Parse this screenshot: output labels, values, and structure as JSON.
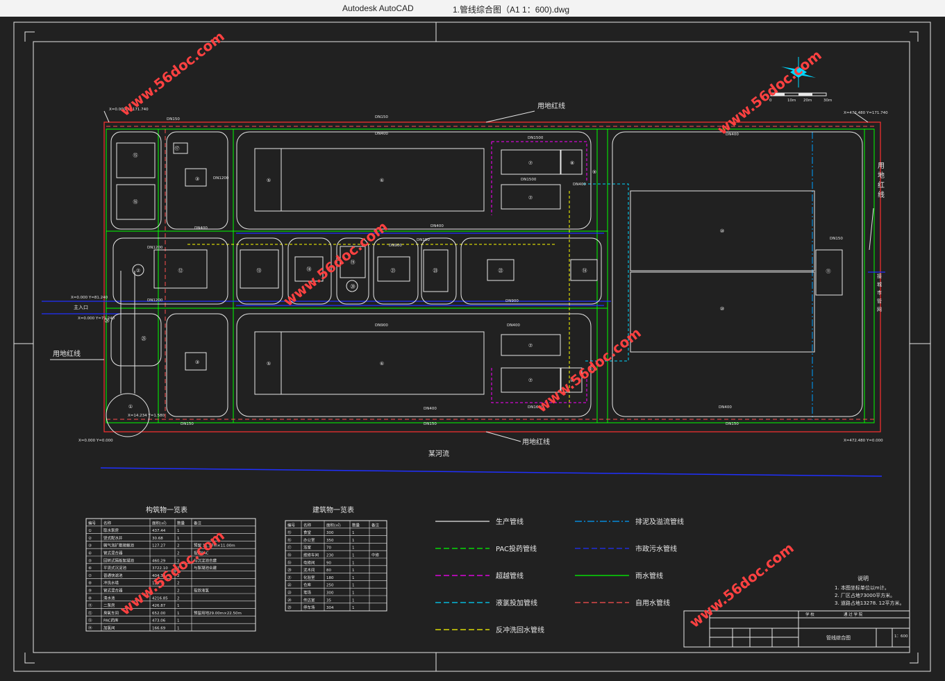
{
  "titlebar": {
    "app": "Autodesk AutoCAD",
    "file": "1.管线综合图（A1 1：600).dwg"
  },
  "labels": {
    "red_line_top": "用地红线",
    "red_line_left": "用地红线",
    "red_line_bottom": "用地红线",
    "red_line_right": [
      "用",
      "地",
      "红",
      "线"
    ],
    "river": "某河流",
    "main_entrance": "主入口",
    "sewer_right": [
      "接",
      "城",
      "市",
      "管",
      "网"
    ]
  },
  "pipe_labels": [
    "DN150",
    "DN400",
    "DN1500",
    "DN1500",
    "DN400",
    "DN150",
    "DN400",
    "DN1200",
    "DN1200",
    "DN400",
    "DN400",
    "DN900",
    "DN900",
    "DN400",
    "DN150",
    "DN150",
    "DN1600",
    "DN150",
    "DN400",
    "DN400",
    "DN900",
    "DN1200",
    "DN150"
  ],
  "watermark": "www.56doc.com",
  "scalebar": [
    "0",
    "10m",
    "20m",
    "30m"
  ],
  "structures_table": {
    "title": "构筑物一览表",
    "headers": [
      "编号",
      "名称",
      "面积(㎡)",
      "数量",
      "备注"
    ],
    "rows": [
      [
        "①",
        "取水泵房",
        "437.44",
        "1",
        ""
      ],
      [
        "②",
        "竖式配水井",
        "30.68",
        "1",
        ""
      ],
      [
        "③",
        "微气泡扩散接触池",
        "127.27",
        "2",
        "预留 11.57m×11.00m"
      ],
      [
        "④",
        "管式混合器",
        "",
        "2",
        "投放PAC"
      ],
      [
        "⑤",
        "回转式隔板絮凝池",
        "460.29",
        "2",
        "与沉淀池合建"
      ],
      [
        "⑥",
        "平流式沉淀池",
        "3722.10",
        "2",
        "与絮凝池合建"
      ],
      [
        "⑦",
        "普通快滤池",
        "404.33",
        "2",
        ""
      ],
      [
        "⑧",
        "冲洗水塔",
        "125.7",
        "2",
        ""
      ],
      [
        "⑨",
        "管式混合器",
        "",
        "2",
        "投放液氯"
      ],
      [
        "⑩",
        "清水池",
        "4216.85",
        "2",
        ""
      ],
      [
        "⑪",
        "二泵房",
        "426.87",
        "1",
        ""
      ],
      [
        "⑫",
        "臭氧车间",
        "652.00",
        "1",
        "预留用地29.00m×22.50m"
      ],
      [
        "⑬",
        "PAC药库",
        "473.06",
        "1",
        ""
      ],
      [
        "⑭",
        "加氯间",
        "166.69",
        "1",
        ""
      ]
    ]
  },
  "buildings_table": {
    "title": "建筑物一览表",
    "headers": [
      "编号",
      "名称",
      "面积(㎡)",
      "数量",
      "备注"
    ],
    "rows": [
      [
        "⑮",
        "食堂",
        "300",
        "1",
        ""
      ],
      [
        "⑯",
        "办公室",
        "350",
        "1",
        ""
      ],
      [
        "⑰",
        "浴室",
        "70",
        "1",
        ""
      ],
      [
        "⑱",
        "维修车间",
        "230",
        "1",
        "中修"
      ],
      [
        "⑲",
        "电修间",
        "90",
        "1",
        ""
      ],
      [
        "⑳",
        "泥木间",
        "80",
        "1",
        ""
      ],
      [
        "㉑",
        "化验室",
        "180",
        "1",
        ""
      ],
      [
        "㉒",
        "仓库",
        "250",
        "1",
        ""
      ],
      [
        "㉓",
        "堆场",
        "300",
        "1",
        ""
      ],
      [
        "㉔",
        "传达室",
        "35",
        "1",
        ""
      ],
      [
        "㉕",
        "停车场",
        "304",
        "1",
        ""
      ]
    ]
  },
  "legend": [
    {
      "label": "生产管线",
      "color": "#e8e8e8",
      "style": "solid"
    },
    {
      "label": "PAC投药管线",
      "color": "#00ff00",
      "style": "dash"
    },
    {
      "label": "超越管线",
      "color": "#ff00ff",
      "style": "dash"
    },
    {
      "label": "液氯投加管线",
      "color": "#00d7ff",
      "style": "dash"
    },
    {
      "label": "反冲洗回水管线",
      "color": "#ffff00",
      "style": "dash"
    },
    {
      "label": "排泥及溢流管线",
      "color": "#00a0ff",
      "style": "dashdot"
    },
    {
      "label": "市政污水管线",
      "color": "#2030ff",
      "style": "dash"
    },
    {
      "label": "雨水管线",
      "color": "#00ff00",
      "style": "solid"
    },
    {
      "label": "自用水管线",
      "color": "#ff5050",
      "style": "dash"
    }
  ],
  "notes": {
    "title": "说明",
    "items": [
      "1. 本图坐标单位以m计。",
      "2. 厂区占地73000平方米。",
      "3. 道路占地13278. 12平方米。"
    ]
  },
  "titleblock": {
    "drawing_name": "管线综合图",
    "scale": "1：600",
    "school": "学 校",
    "dept": "通 过 学 院"
  },
  "coords": [
    "X=0.000 Y=171.740",
    "X=472.480 Y=171.740",
    "X=0.000 Y=0.000",
    "X=472.480 Y=0.000",
    "X=14.234 Y=1.580",
    "X=0.000 Y=81.240",
    "X=0.000 Y=71.240"
  ],
  "colors": {
    "background": "#212121",
    "red_line": "#ff3030",
    "frame": "#e8e8e8",
    "green": "#00ff00",
    "watermark": "#ff4141"
  }
}
